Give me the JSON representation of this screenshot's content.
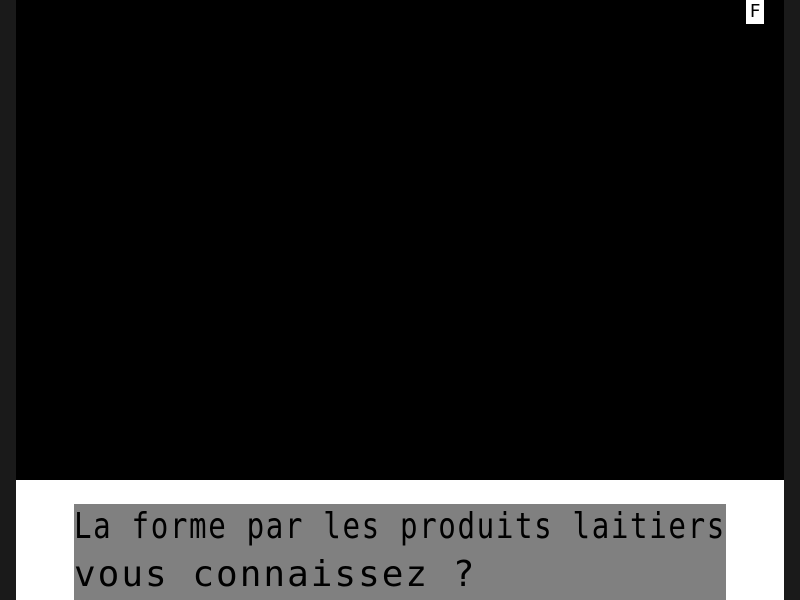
{
  "status": {
    "indicator": "F"
  },
  "prompt": {
    "line1": "La forme par les produits laitiers",
    "line2": "vous connaissez ?"
  },
  "colors": {
    "background": "#000000",
    "text_box": "#808080",
    "text": "#000000",
    "frame": "#ffffff"
  }
}
